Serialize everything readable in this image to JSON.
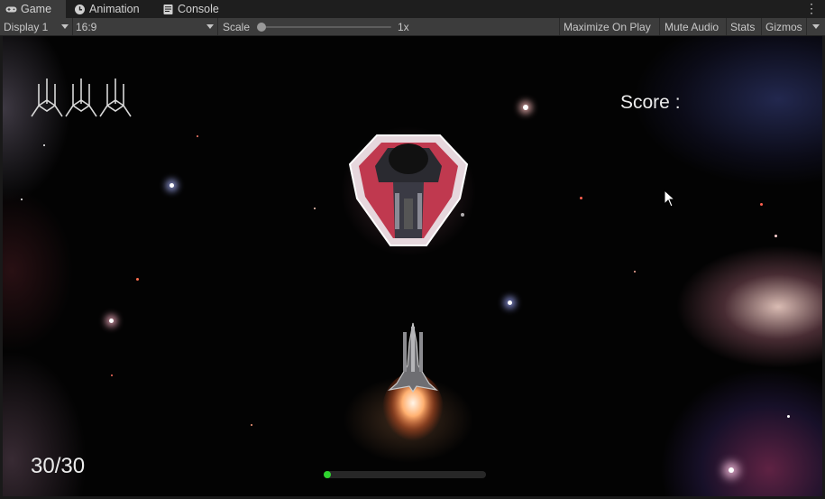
{
  "tabs": [
    {
      "label": "Game",
      "icon": "gamepad-icon",
      "active": true
    },
    {
      "label": "Animation",
      "icon": "clock-icon",
      "active": false
    },
    {
      "label": "Console",
      "icon": "console-icon",
      "active": false
    }
  ],
  "toolbar": {
    "display": "Display 1",
    "aspect": "16:9",
    "scale_label": "Scale",
    "scale_value": "1x",
    "maximize_label": "Maximize On Play",
    "mute_label": "Mute Audio",
    "stats_label": "Stats",
    "gizmos_label": "Gizmos"
  },
  "hud": {
    "lives": 3,
    "score_label": "Score :",
    "ammo_text": "30/30",
    "progress": 0.02
  },
  "colors": {
    "progress_fill": "#2fd42f",
    "enemy_hull": "#c0394f",
    "engine_glow": "#ffb070"
  }
}
